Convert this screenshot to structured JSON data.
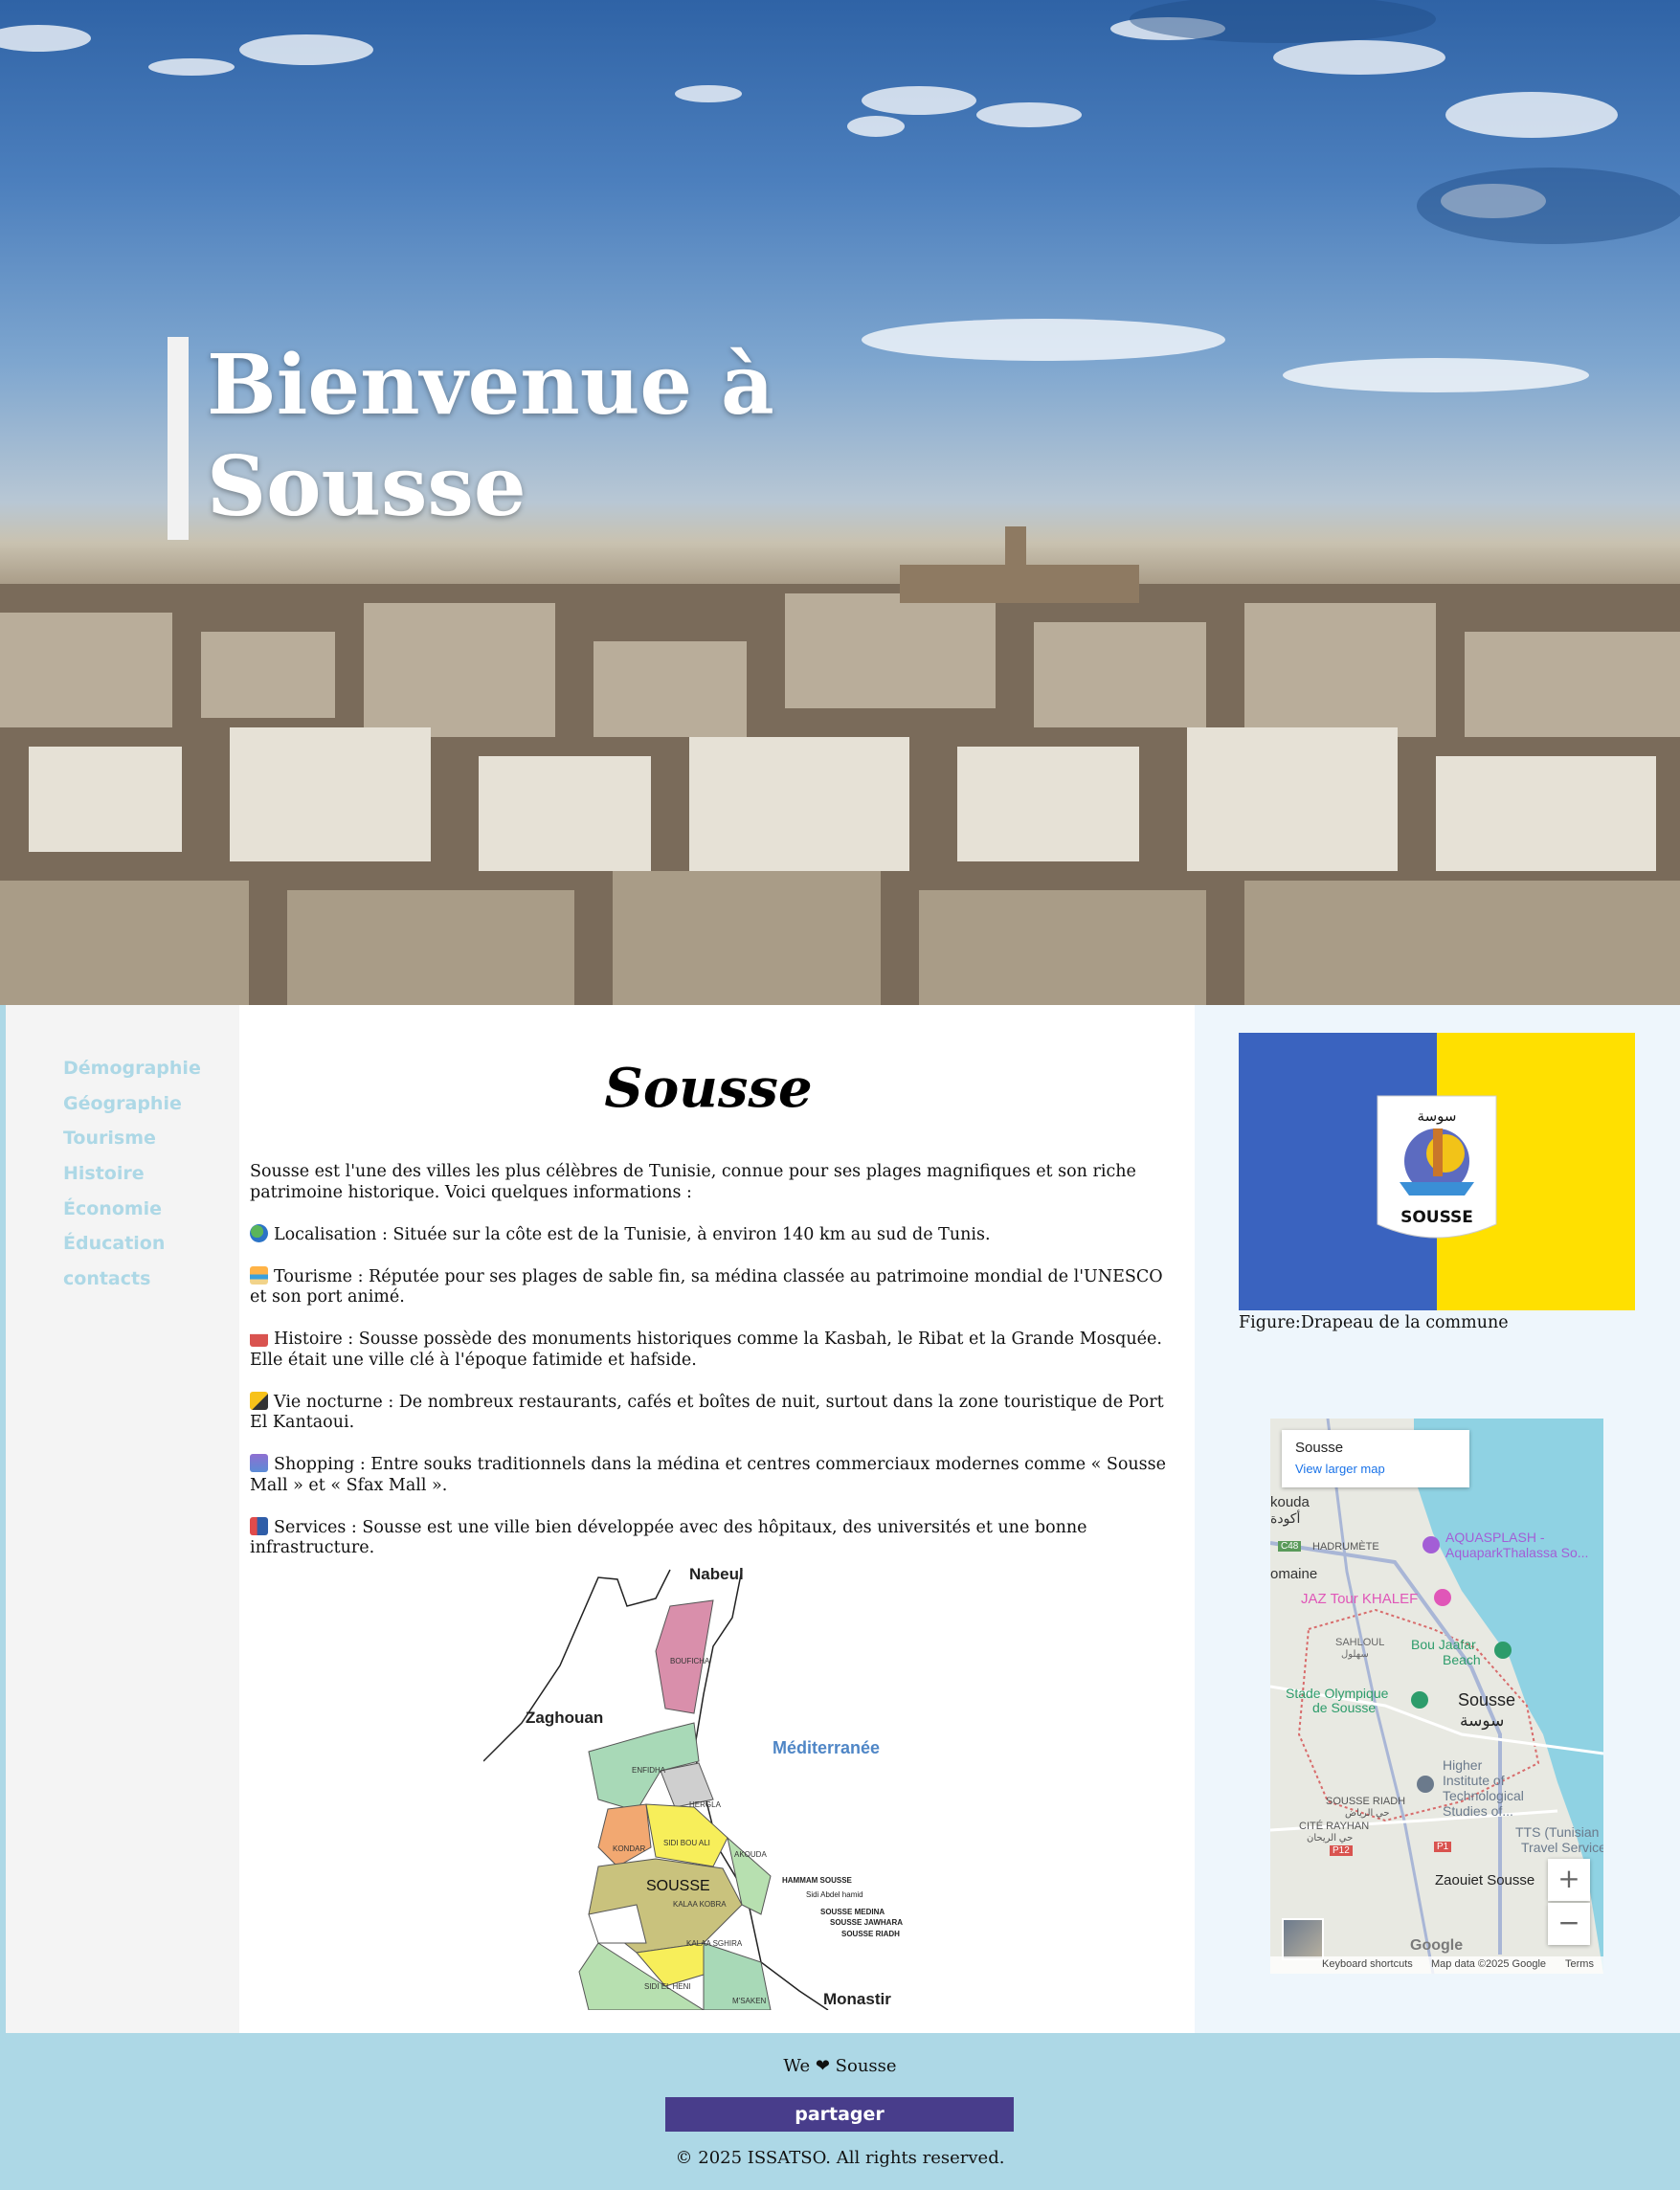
{
  "hero": {
    "title_line1": "Bienvenue à",
    "title_line2": "Sousse"
  },
  "nav": {
    "items": [
      {
        "label": "Démographie"
      },
      {
        "label": "Géographie"
      },
      {
        "label": "Tourisme"
      },
      {
        "label": "Histoire"
      },
      {
        "label": "Économie"
      },
      {
        "label": "Éducation"
      },
      {
        "label": "contacts"
      }
    ]
  },
  "main": {
    "title": "Sousse",
    "intro": "Sousse est l'une des villes les plus célèbres de Tunisie, connue pour ses plages magnifiques et son riche patrimoine historique. Voici quelques informations :",
    "facts": [
      {
        "icon": "globe-icon",
        "text": "Localisation : Située sur la côte est de la Tunisie, à environ 140 km au sud de Tunis."
      },
      {
        "icon": "beach-icon",
        "text": "Tourisme : Réputée pour ses plages de sable fin, sa médina classée au patrimoine mondial de l'UNESCO et son port animé."
      },
      {
        "icon": "castle-icon",
        "text": "Histoire : Sousse possède des monuments historiques comme la Kasbah, le Ribat et la Grande Mosquée. Elle était une ville clé à l'époque fatimide et hafside."
      },
      {
        "icon": "party-icon",
        "text": "Vie nocturne : De nombreux restaurants, cafés et boîtes de nuit, surtout dans la zone touristique de Port El Kantaoui."
      },
      {
        "icon": "shopping-icon",
        "text": "Shopping : Entre souks traditionnels dans la médina et centres commerciaux modernes comme « Sousse Mall » et « Sfax Mall »."
      },
      {
        "icon": "hospital-icon",
        "text": "Services : Sousse est une ville bien développée avec des hôpitaux, des universités et une bonne infrastructure."
      }
    ],
    "governorate_map": {
      "labels": {
        "nabeul": "Nabeul",
        "zaghouan": "Zaghouan",
        "mediterranee": "Méditerranée",
        "monastir": "Monastir",
        "bouficha": "BOUFICHA",
        "enfidha": "ENFIDHA",
        "hergla": "HERGLA",
        "kondar": "KONDAR",
        "sidi_bou_ali": "SIDI BOU ALI",
        "akouda": "AKOUDA",
        "sousse": "SOUSSE",
        "kalaa_kobra": "KALAA KOBRA",
        "kalaa_sghira": "KALAA SGHIRA",
        "sidi_el_heni": "SIDI EL HENI",
        "msaken": "M'SAKEN",
        "hammam_sousse": "HAMMAM SOUSSE",
        "sidi_abdel_hamid": "Sidi Abdel hamid",
        "sousse_medina": "SOUSSE MEDINA",
        "sousse_jawhara": "SOUSSE JAWHARA",
        "sousse_riadh": "SOUSSE RIADH"
      }
    }
  },
  "aside": {
    "flag_text": "SOUSSE",
    "flag_arabic": "سوسة",
    "flag_caption": "Figure:Drapeau de la commune",
    "colors": {
      "flag_blue": "#3a63bf",
      "flag_yellow": "#ffe000"
    },
    "google_map": {
      "place": "Sousse",
      "larger_map_link": "View larger map",
      "labels": {
        "akouda": "kouda",
        "akouda_ar": "أكودة",
        "hadrumete": "HADRUMÈTE",
        "omaine": "omaine",
        "aquasplash": "AQUASPLASH -",
        "aquapark": "AquaparkThalassa So...",
        "jaz": "JAZ Tour KHALEF",
        "sahloul": "SAHLOUL",
        "sahloul_ar": "سهلول",
        "bou_jaafar": "Bou Jaafar",
        "beach": "Beach",
        "stade": "Stade Olympique",
        "de_sousse": "de Sousse",
        "sousse": "Sousse",
        "sousse_ar": "سوسة",
        "higher1": "Higher",
        "higher2": "Institute of",
        "higher3": "Technological",
        "higher4": "Studies of...",
        "riadh": "SOUSSE RIADH",
        "riadh_ar": "حي الرياض",
        "cite": "CITÉ RAYHAN",
        "cite_ar": "حي الريحان",
        "tts1": "TTS (Tunisian",
        "tts2": "Travel Service)",
        "zaouiet": "Zaouiet Sousse",
        "c48": "C48",
        "p12": "P12",
        "p1": "P1",
        "google": "Google"
      },
      "zoom_in": "+",
      "zoom_out": "−",
      "footer": {
        "shortcuts": "Keyboard shortcuts",
        "data": "Map data ©2025 Google",
        "terms": "Terms"
      }
    }
  },
  "footer": {
    "love_prefix": "We",
    "love_heart": "❤",
    "love_suffix": "Sousse",
    "share_label": "partager",
    "copyright": "© 2025 ISSATSO. All rights reserved.",
    "colors": {
      "footer_bg": "#add8e6",
      "button_bg": "#483d8b"
    }
  }
}
